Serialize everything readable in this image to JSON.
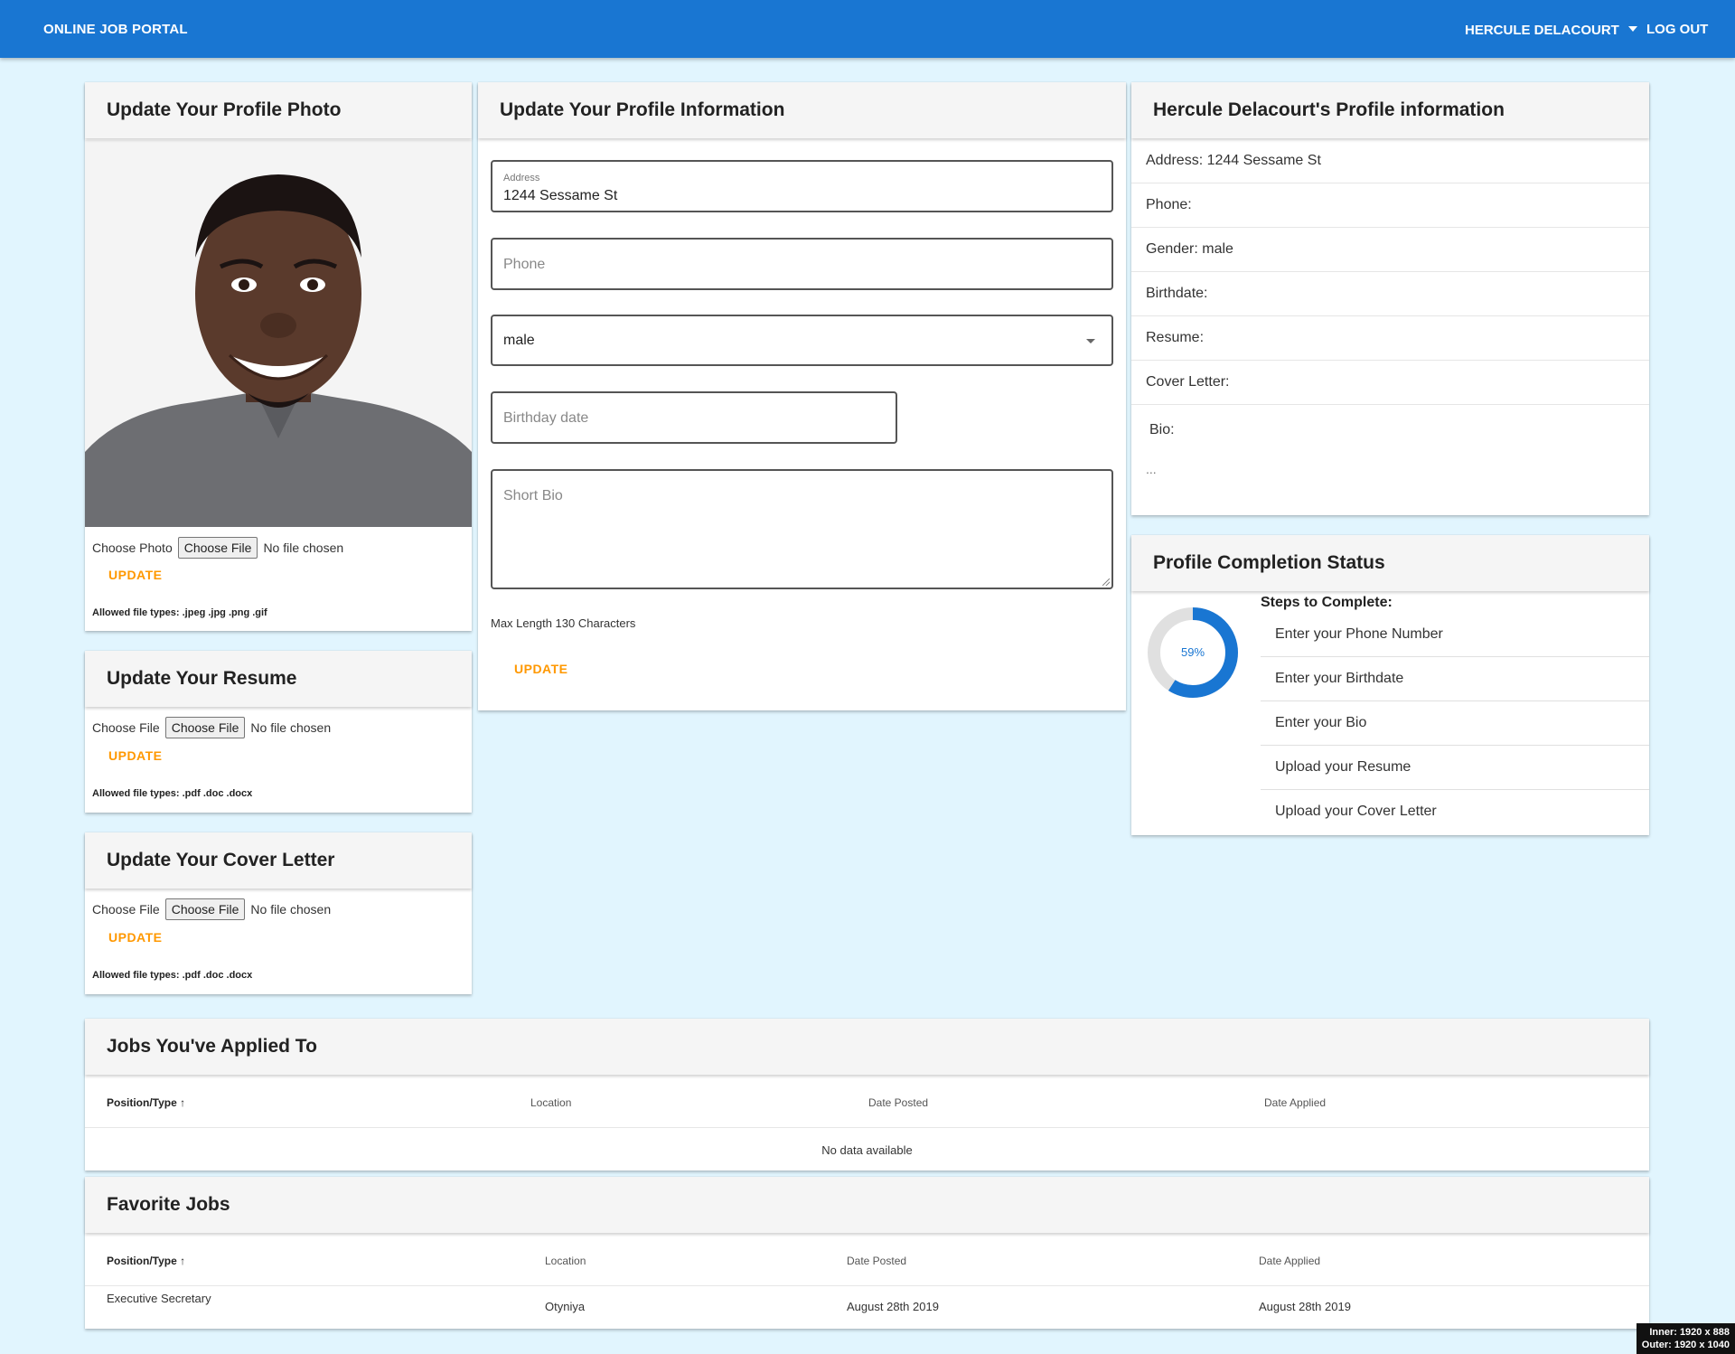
{
  "header": {
    "brand": "ONLINE JOB PORTAL",
    "user_name": "HERCULE DELACOURT",
    "logout": "LOG OUT"
  },
  "photo_card": {
    "title": "Update Your Profile Photo",
    "choose_label": "Choose Photo",
    "choose_button": "Choose File",
    "no_file": "No file chosen",
    "update": "UPDATE",
    "allowed": "Allowed file types: .jpeg .jpg .png .gif"
  },
  "resume_card": {
    "title": "Update Your Resume",
    "choose_label": "Choose File",
    "choose_button": "Choose File",
    "no_file": "No file chosen",
    "update": "UPDATE",
    "allowed": "Allowed file types: .pdf .doc .docx"
  },
  "cover_card": {
    "title": "Update Your Cover Letter",
    "choose_label": "Choose File",
    "choose_button": "Choose File",
    "no_file": "No file chosen",
    "update": "UPDATE",
    "allowed": "Allowed file types: .pdf .doc .docx"
  },
  "profile_form": {
    "title": "Update Your Profile Information",
    "address_label": "Address",
    "address_value": "1244 Sessame St",
    "phone_placeholder": "Phone",
    "gender_value": "male",
    "birthday_placeholder": "Birthday date",
    "bio_placeholder": "Short Bio",
    "max_length_hint": "Max Length 130 Characters",
    "update": "UPDATE"
  },
  "profile_info": {
    "title": "Hercule Delacourt's Profile information",
    "address": "Address: 1244 Sessame St",
    "phone": "Phone:",
    "gender": "Gender: male",
    "birthdate": "Birthdate:",
    "resume": "Resume:",
    "cover_letter": "Cover Letter:",
    "bio_label": "Bio:",
    "bio_value": "..."
  },
  "completion": {
    "title": "Profile Completion Status",
    "percent": 59,
    "percent_label": "59%",
    "steps_title": "Steps to Complete:",
    "steps": [
      "Enter your Phone Number",
      "Enter your Birthdate",
      "Enter your Bio",
      "Upload your Resume",
      "Upload your Cover Letter"
    ],
    "colors": {
      "progress": "#1976d2",
      "track": "#e0e0e0"
    }
  },
  "applied_jobs": {
    "title": "Jobs You've Applied To",
    "columns": [
      "Position/Type",
      "Location",
      "Date Posted",
      "Date Applied"
    ],
    "empty_text": "No data available"
  },
  "favorite_jobs": {
    "title": "Favorite Jobs",
    "columns": [
      "Position/Type",
      "Location",
      "Date Posted",
      "Date Applied"
    ],
    "rows": [
      {
        "position": "Executive Secretary",
        "location": "Otyniya",
        "date_posted": "August 28th 2019",
        "date_applied": "August 28th 2019"
      }
    ]
  },
  "viewport_badge": {
    "inner": "Inner: 1920 x 888",
    "outer": "Outer: 1920 x 1040"
  },
  "colors": {
    "primary": "#1976d2",
    "accent": "#ff9800",
    "background": "#e1f5fe"
  }
}
